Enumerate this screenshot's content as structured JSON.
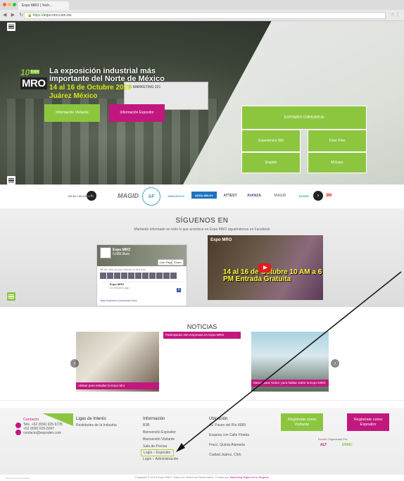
{
  "browser": {
    "tab_title": "Expo MRO | Tech...",
    "protocol": "https://",
    "url": "expo-mro.com.mx"
  },
  "hero": {
    "logo_number": "10",
    "logo_expo": "Expo",
    "logo_mro": "MRO",
    "headline": "La exposición industrial más importante del Norte de México",
    "date": "14 al 16 de Octubre 2020",
    "city": "Juárez México",
    "booth_text": "TK MARKETING  221",
    "btn_visitante": "Información Visitante",
    "btn_expositor": "Información Expositor",
    "box_chihuahua": "EXPOMRO CHIHUAHUA",
    "box_experiencia": "Experiencia 360",
    "box_floorplan": "Floor Plan",
    "box_english": "English",
    "box_mexpo": "M-Expo"
  },
  "sponsors": {
    "items": [
      "GE BY CELUPREMI",
      "MAGID",
      "AF",
      "ABRASIVOS",
      "ASSA ABLOY",
      "ATTEST",
      "AVANZA",
      "MAGID",
      "BARRE",
      "3M"
    ]
  },
  "social": {
    "title": "SÍGUENOS EN",
    "subtitle": "Mantente informado en todo lo que acontece en Expo MRO siguiéndonos en Facebook",
    "fb_page_name": "Expo MRO",
    "fb_page_sub": "5,685 likes",
    "fb_like": "Like Page",
    "fb_share": "Share",
    "fb_friends": "Be the first of your friends to like this",
    "fb_post_name": "Expo MRO",
    "fb_post_time": "31 minutes ago",
    "fb_link": "https://expomro.com/contact-form/",
    "video_channel": "Expo MRO",
    "video_text": "14 al 16 de Octubre 10 AM a 6 PM Entrada Gratuita"
  },
  "noticias": {
    "title": "NOTICIAS",
    "cards": [
      {
        "caption": "Alistan para estudiar la Expo Mro"
      },
      {
        "caption": "Participarán 400 empresas en Expo MRO"
      },
      {
        "caption": "Mexus para Todos: para hablar sobre la Expo MRO"
      }
    ]
  },
  "footer": {
    "contact_heading": "Contacto",
    "phone1": "Tels. +52 (656) 625-6735",
    "phone2": "+52 (656) 625-5047",
    "email": "contacto@expoden.com",
    "links_heading": "Ligas de Interés",
    "links_item": "Realidades de la Industria",
    "info_heading": "Información",
    "info_items": [
      "B2B",
      "Bienvenido Expositor",
      "Bienvenido Visitante",
      "Sala de Prensa",
      "Login – Expositor",
      "Login – Administración"
    ],
    "location_heading": "Ubicación",
    "location_items": [
      "Av. Paseo del Río 8989",
      "Esquina con Calle Florida",
      "Fracc. Quinta Alameda",
      "Ciudad Juárez, Chih."
    ],
    "btn_visitante": "Regístrate como Visitante",
    "btn_expositor": "Regístrate como Expositor",
    "organized_by": "Evento Organizado Por:",
    "org_logo1": "ALT",
    "org_logo2": "ERMC",
    "copyright": "Copyright © 2019 Expo MRO. Todos los Derechos Reservados. Creado por",
    "copyright_link": "Marketing Digital en tu Negocio",
    "tiny_text": "Web Content Accessibility"
  },
  "colors": {
    "brand_green": "#8cc63f",
    "brand_magenta": "#c2177f",
    "headline_yellow": "#d4e60d"
  }
}
